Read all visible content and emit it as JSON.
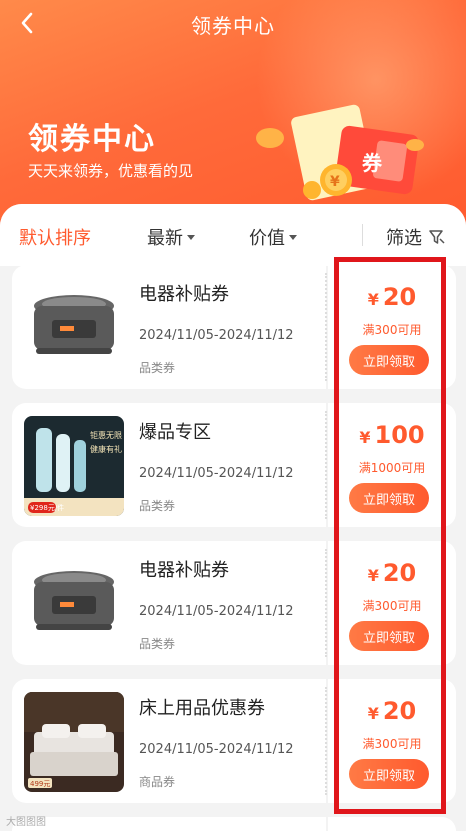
{
  "nav": {
    "title": "领券中心",
    "back_icon": "chevron-left-icon"
  },
  "hero": {
    "title": "领券中心",
    "subtitle": "天天来领券，优惠看的见"
  },
  "sort": {
    "default": "默认排序",
    "newest": "最新",
    "value": "价值",
    "filter": "筛选",
    "filter_icon": "filter-icon",
    "active_color": "#ff5a2e"
  },
  "coupons": [
    {
      "title": "电器补贴券",
      "date": "2024/11/05-2024/11/12",
      "type": "品类券",
      "currency": "¥",
      "amount": "20",
      "condition": "满300可用",
      "button": "立即领取",
      "image": "rice-cooker"
    },
    {
      "title": "爆品专区",
      "date": "2024/11/05-2024/11/12",
      "type": "品类券",
      "currency": "¥",
      "amount": "100",
      "condition": "满1000可用",
      "button": "立即领取",
      "image": "thermos-bottles",
      "image_text": {
        "line1": "钜惠无限",
        "line2": "健康有礼",
        "price": "¥298元/件"
      }
    },
    {
      "title": "电器补贴券",
      "date": "2024/11/05-2024/11/12",
      "type": "品类券",
      "currency": "¥",
      "amount": "20",
      "condition": "满300可用",
      "button": "立即领取",
      "image": "rice-cooker"
    },
    {
      "title": "床上用品优惠券",
      "date": "2024/11/05-2024/11/12",
      "type": "商品券",
      "currency": "¥",
      "amount": "20",
      "condition": "满300可用",
      "button": "立即领取",
      "image": "bedding",
      "image_text": {
        "price": "499元"
      }
    }
  ],
  "watermark": "大图图图",
  "colors": {
    "accent": "#ff5a2e",
    "highlight": "#e0161b"
  }
}
